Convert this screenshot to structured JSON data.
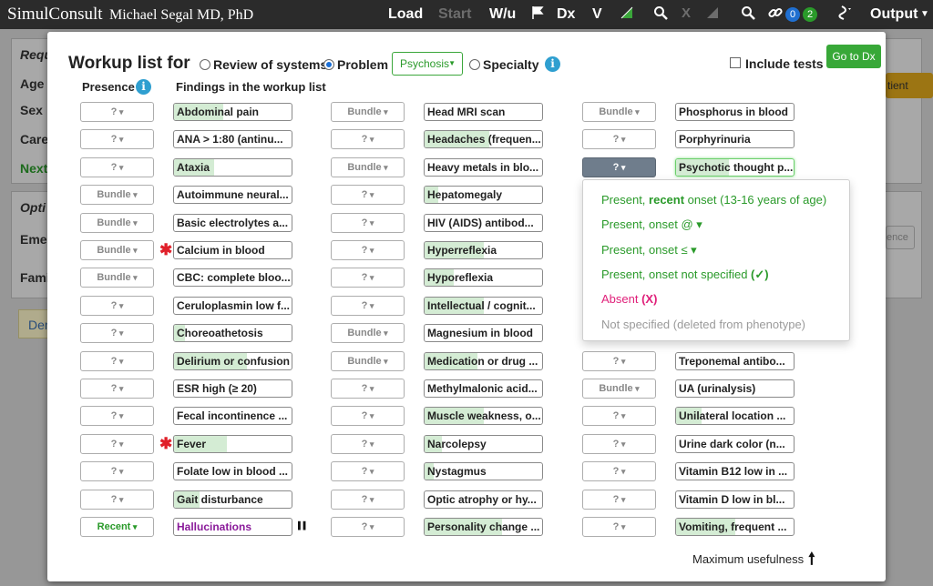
{
  "navbar": {
    "brand": "SimulConsult",
    "user": "Michael Segal MD, PhD",
    "items": [
      "Load",
      "Start",
      "W/u",
      "Dx",
      "V",
      "Output"
    ],
    "badges": [
      "0",
      "2"
    ],
    "badge_colors": [
      "#1f6fd0",
      "#2a9a2a"
    ],
    "icons": [
      "flag-icon",
      "triangle-icon",
      "search-icon",
      "x-icon",
      "triangle-icon",
      "search-icon",
      "link-icon",
      "gene-icon"
    ]
  },
  "background": {
    "labels": [
      "Requ",
      "Age",
      "Sex",
      "Care",
      "Next",
      "Opti",
      "Emer",
      "Fami",
      "Den"
    ],
    "button_fragment": "tient",
    "input_fragment": "ence"
  },
  "modal": {
    "title": "Workup list for",
    "radios": [
      {
        "label": "Review of systems",
        "selected": false
      },
      {
        "label": "Problem",
        "selected": true
      },
      {
        "label": "Specialty",
        "selected": false
      }
    ],
    "problem_select": "Psychosis",
    "include_tests": "Include tests",
    "go_to_dx": "Go to Dx",
    "headers": {
      "presence": "Presence",
      "findings": "Findings in the workup list"
    },
    "footer": "Maximum usefulness",
    "columns": [
      [
        {
          "presence": "?",
          "finding": "Abdominal pain",
          "score": 0.42
        },
        {
          "presence": "?",
          "finding": "ANA > 1:80 (antinu...",
          "score": 0.0
        },
        {
          "presence": "?",
          "finding": "Ataxia",
          "score": 0.34
        },
        {
          "presence": "Bundle",
          "finding": "Autoimmune neural...",
          "score": 0.0
        },
        {
          "presence": "Bundle",
          "finding": "Basic electrolytes a...",
          "score": 0.0
        },
        {
          "presence": "Bundle",
          "finding": "Calcium in blood",
          "score": 0.0,
          "starred": true
        },
        {
          "presence": "Bundle",
          "finding": "CBC: complete bloo...",
          "score": 0.0
        },
        {
          "presence": "?",
          "finding": "Ceruloplasmin low f...",
          "score": 0.0
        },
        {
          "presence": "?",
          "finding": "Choreoathetosis",
          "score": 0.09
        },
        {
          "presence": "?",
          "finding": "Delirium or confusion",
          "score": 0.62
        },
        {
          "presence": "?",
          "finding": "ESR high (≥ 20)",
          "score": 0.0
        },
        {
          "presence": "?",
          "finding": "Fecal incontinence ...",
          "score": 0.0
        },
        {
          "presence": "?",
          "finding": "Fever",
          "score": 0.45,
          "starred": true
        },
        {
          "presence": "?",
          "finding": "Folate low in blood ...",
          "score": 0.0
        },
        {
          "presence": "?",
          "finding": "Gait disturbance",
          "score": 0.22
        },
        {
          "presence": "Recent",
          "finding": "Hallucinations",
          "score": 0.0,
          "purple": true,
          "paused": true
        }
      ],
      [
        {
          "presence": "Bundle",
          "finding": "Head MRI scan",
          "score": 0.0
        },
        {
          "presence": "?",
          "finding": "Headaches (frequen...",
          "score": 0.55
        },
        {
          "presence": "Bundle",
          "finding": "Heavy metals in blo...",
          "score": 0.0
        },
        {
          "presence": "?",
          "finding": "Hepatomegaly",
          "score": 0.12
        },
        {
          "presence": "?",
          "finding": "HIV (AIDS) antibod...",
          "score": 0.0
        },
        {
          "presence": "?",
          "finding": "Hyperreflexia",
          "score": 0.5
        },
        {
          "presence": "?",
          "finding": "Hyporeflexia",
          "score": 0.25
        },
        {
          "presence": "?",
          "finding": "Intellectual / cognit...",
          "score": 0.5
        },
        {
          "presence": "Bundle",
          "finding": "Magnesium in blood",
          "score": 0.0
        },
        {
          "presence": "Bundle",
          "finding": "Medication or drug ...",
          "score": 0.45
        },
        {
          "presence": "?",
          "finding": "Methylmalonic acid...",
          "score": 0.0
        },
        {
          "presence": "?",
          "finding": "Muscle weakness, o...",
          "score": 0.5
        },
        {
          "presence": "?",
          "finding": "Narcolepsy",
          "score": 0.15
        },
        {
          "presence": "?",
          "finding": "Nystagmus",
          "score": 0.08
        },
        {
          "presence": "?",
          "finding": "Optic atrophy or hy...",
          "score": 0.0
        },
        {
          "presence": "?",
          "finding": "Personality change ...",
          "score": 0.66
        }
      ],
      [
        {
          "presence": "Bundle",
          "finding": "Phosphorus in blood",
          "score": 0.0
        },
        {
          "presence": "?",
          "finding": "Porphyrinuria",
          "score": 0.0
        },
        {
          "presence": "?",
          "finding": "Psychotic thought p...",
          "score": 0.45,
          "active": true
        },
        {
          "presence": "",
          "finding": "",
          "score": 0.0,
          "hidden": true
        },
        {
          "presence": "",
          "finding": "",
          "score": 0.0,
          "hidden": true
        },
        {
          "presence": "",
          "finding": "",
          "score": 0.0,
          "hidden": true
        },
        {
          "presence": "",
          "finding": "",
          "score": 0.0,
          "hidden": true
        },
        {
          "presence": "",
          "finding": "",
          "score": 0.0,
          "hidden": true
        },
        {
          "presence": "",
          "finding": "",
          "score": 0.0,
          "hidden": true
        },
        {
          "presence": "?",
          "finding": "Treponemal antibo...",
          "score": 0.0
        },
        {
          "presence": "Bundle",
          "finding": "UA (urinalysis)",
          "score": 0.0
        },
        {
          "presence": "?",
          "finding": "Unilateral location ...",
          "score": 0.22
        },
        {
          "presence": "?",
          "finding": "Urine dark color (n...",
          "score": 0.0
        },
        {
          "presence": "?",
          "finding": "Vitamin B12 low in ...",
          "score": 0.0
        },
        {
          "presence": "?",
          "finding": "Vitamin D low in bl...",
          "score": 0.0
        },
        {
          "presence": "?",
          "finding": "Vomiting, frequent ...",
          "score": 0.5
        }
      ]
    ],
    "dropdown": [
      {
        "prefix": "Present, ",
        "bold": "recent",
        "suffix": " onset (13-16 years of age)",
        "color": "#2a9a2a"
      },
      {
        "prefix": "Present, onset @ ▾",
        "bold": "",
        "suffix": "",
        "color": "#2a9a2a"
      },
      {
        "prefix": "Present, onset ≤ ▾",
        "bold": "",
        "suffix": "",
        "color": "#2a9a2a"
      },
      {
        "prefix": "Present, onset not specified ",
        "bold": "(✓)",
        "suffix": "",
        "color": "#2a9a2a"
      },
      {
        "prefix": "Absent ",
        "bold": "(X)",
        "suffix": "",
        "color": "#e0207a"
      },
      {
        "prefix": "Not specified (deleted from phenotype)",
        "bold": "",
        "suffix": "",
        "color": "#9a9a9a"
      }
    ]
  }
}
